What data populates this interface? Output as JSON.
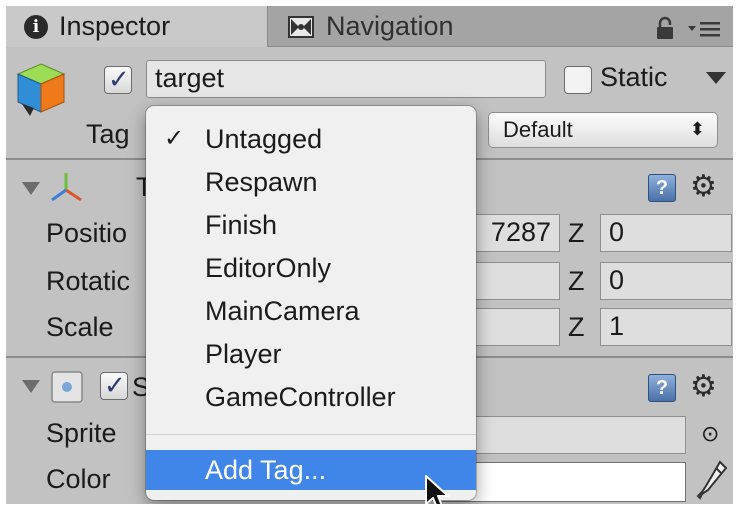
{
  "tabs": {
    "inspector": "Inspector",
    "navigation": "Navigation"
  },
  "icons": {
    "info": "i",
    "help": "?",
    "gear": "⚙",
    "check": "✓",
    "picker": "⊙"
  },
  "gameobject": {
    "name": "target",
    "static_label": "Static",
    "tag_label": "Tag",
    "layer_label": "r",
    "layer_value": "Default",
    "layer_arrows": "⬍"
  },
  "transform": {
    "title_fragment": "T",
    "position_label": "Positio",
    "rotation_label": "Rotatic",
    "scale_label": "Scale",
    "position_x_fragment": "7287",
    "position_z": "0",
    "rotation_z": "0",
    "scale_z": "1",
    "z_label": "Z"
  },
  "sprite_renderer": {
    "title_fragment": "S",
    "sprite_label": "Sprite",
    "sprite_value_fragment": "et",
    "color_label": "Color",
    "color_value": "#ffffff"
  },
  "tag_dropdown": {
    "items": [
      "Untagged",
      "Respawn",
      "Finish",
      "EditorOnly",
      "MainCamera",
      "Player",
      "GameController"
    ],
    "selected": "Untagged",
    "add_tag": "Add Tag..."
  },
  "colors": {
    "highlight": "#3f86e8",
    "panel": "#c2c2c2",
    "tabbar": "#a4a4a4"
  }
}
